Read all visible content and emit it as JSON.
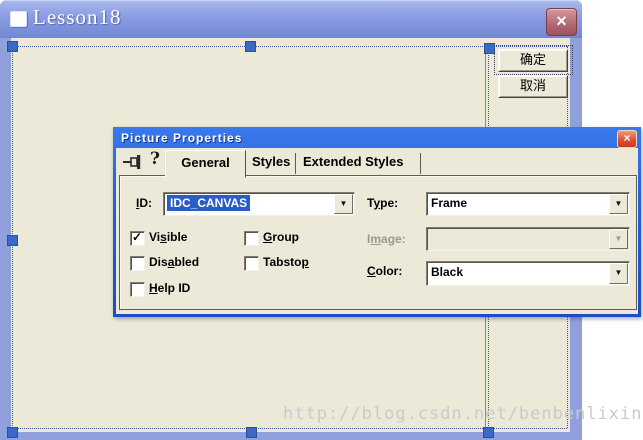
{
  "editor": {
    "title": "Lesson18",
    "ok_label": "确定",
    "cancel_label": "取消",
    "watermark": "http://blog.csdn.net/benbenlixin"
  },
  "props": {
    "title": "Picture Properties",
    "tabs": [
      {
        "label": "General",
        "active": true
      },
      {
        "label": "Styles",
        "active": false
      },
      {
        "label": "Extended Styles",
        "active": false
      }
    ],
    "fields": {
      "id_label": {
        "pre": "",
        "mn": "I",
        "post": "D:"
      },
      "id_value": "IDC_CANVAS",
      "type_label": {
        "pre": "T",
        "mn": "y",
        "post": "pe:"
      },
      "type_value": "Frame",
      "image_label": {
        "pre": "I",
        "mn": "m",
        "post": "age:"
      },
      "image_value": "",
      "color_label": {
        "pre": "",
        "mn": "C",
        "post": "olor:"
      },
      "color_value": "Black"
    },
    "checks": {
      "visible": {
        "pre": "Vi",
        "mn": "s",
        "post": "ible",
        "glyph": "✓"
      },
      "group": {
        "pre": "",
        "mn": "G",
        "post": "roup",
        "glyph": ""
      },
      "disabled": {
        "pre": "Dis",
        "mn": "a",
        "post": "bled",
        "glyph": ""
      },
      "tabstop": {
        "pre": "Tabsto",
        "mn": "p",
        "post": "",
        "glyph": ""
      },
      "helpid": {
        "pre": "",
        "mn": "H",
        "post": "elp ID",
        "glyph": ""
      }
    }
  },
  "icons": {
    "close_glyph": "×",
    "combo_arrow": "▼",
    "help_glyph": "?"
  },
  "colors": {
    "editor_face": "#ece9d8",
    "frame_periwinkle": "#8fa0dd",
    "props_titlebar_blue": "#2260dc",
    "selection_blue": "#2b5cc6",
    "handle_blue": "#3b69c6",
    "close_red": "#dd5336",
    "main_close_rose": "#b66b76",
    "watermark_gray": "#cacaca"
  }
}
